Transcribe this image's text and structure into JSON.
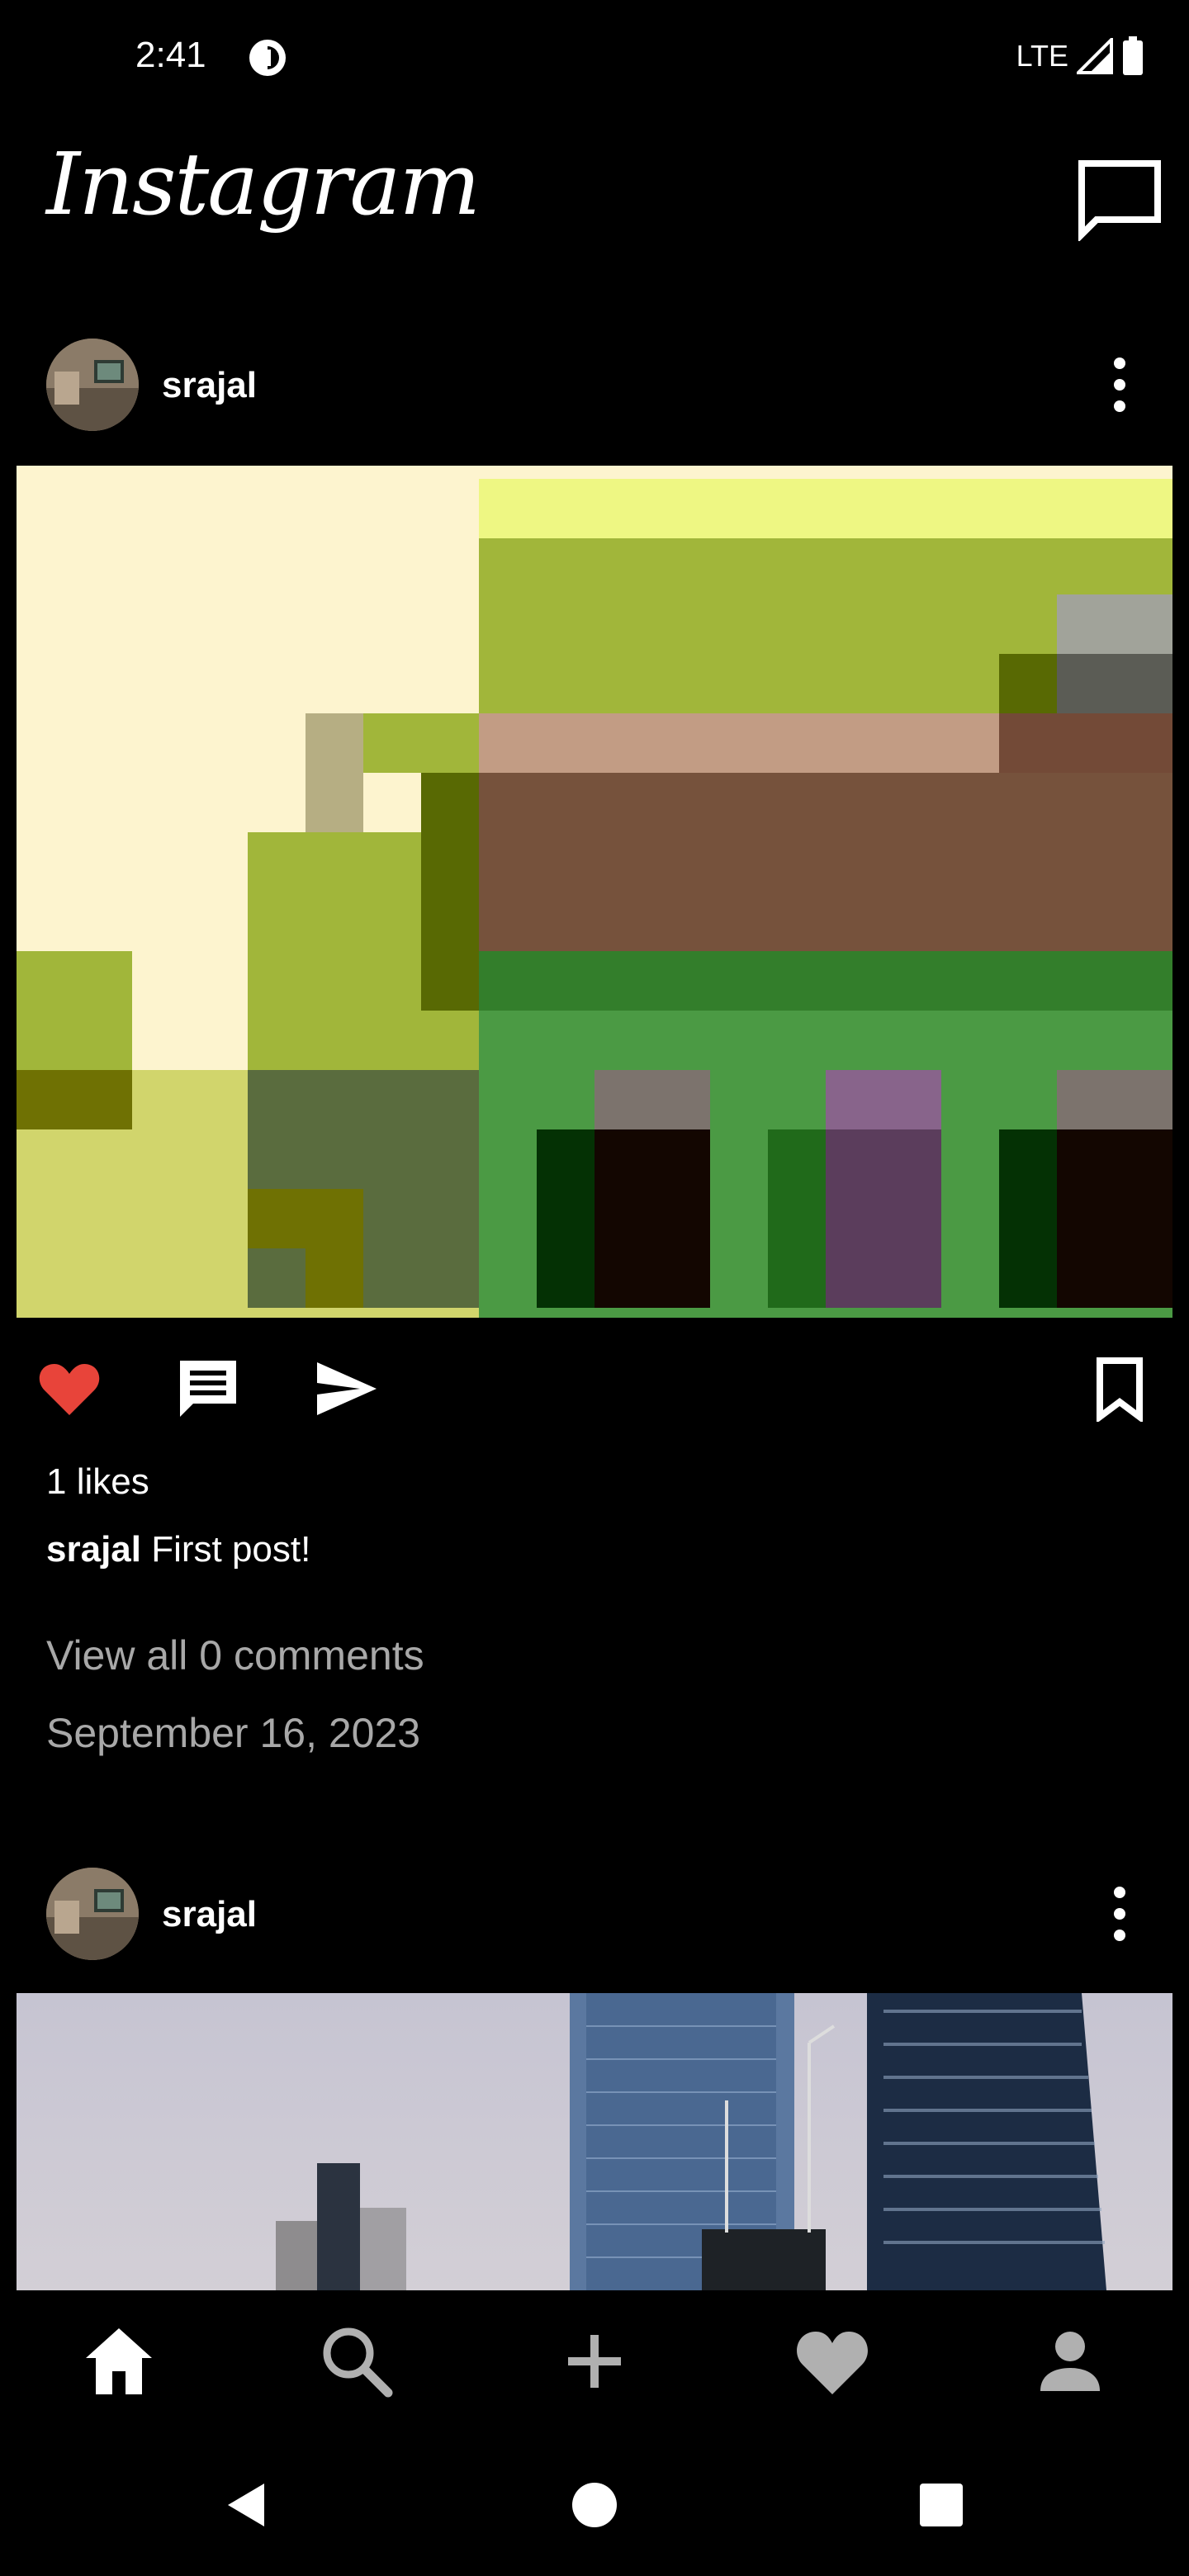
{
  "status_bar": {
    "time": "2:41",
    "network": "LTE",
    "icons": [
      "dnd-icon",
      "signal-icon",
      "battery-icon"
    ]
  },
  "app_bar": {
    "title": "Instagram",
    "icons": [
      "messages-icon"
    ]
  },
  "posts": [
    {
      "username": "srajal",
      "likes": "1 likes",
      "caption_user": "srajal",
      "caption_text": " First post!",
      "comments_link": "View all 0 comments",
      "date": "September 16, 2023",
      "liked": true
    },
    {
      "username": "srajal"
    }
  ],
  "bottom_nav": {
    "items": [
      "home-icon",
      "search-icon",
      "add-icon",
      "heart-icon",
      "profile-icon"
    ],
    "active": "home-icon"
  },
  "colors": {
    "like_red": "#e8443a",
    "secondary_text": "#a8a8a8",
    "background": "#000000"
  }
}
